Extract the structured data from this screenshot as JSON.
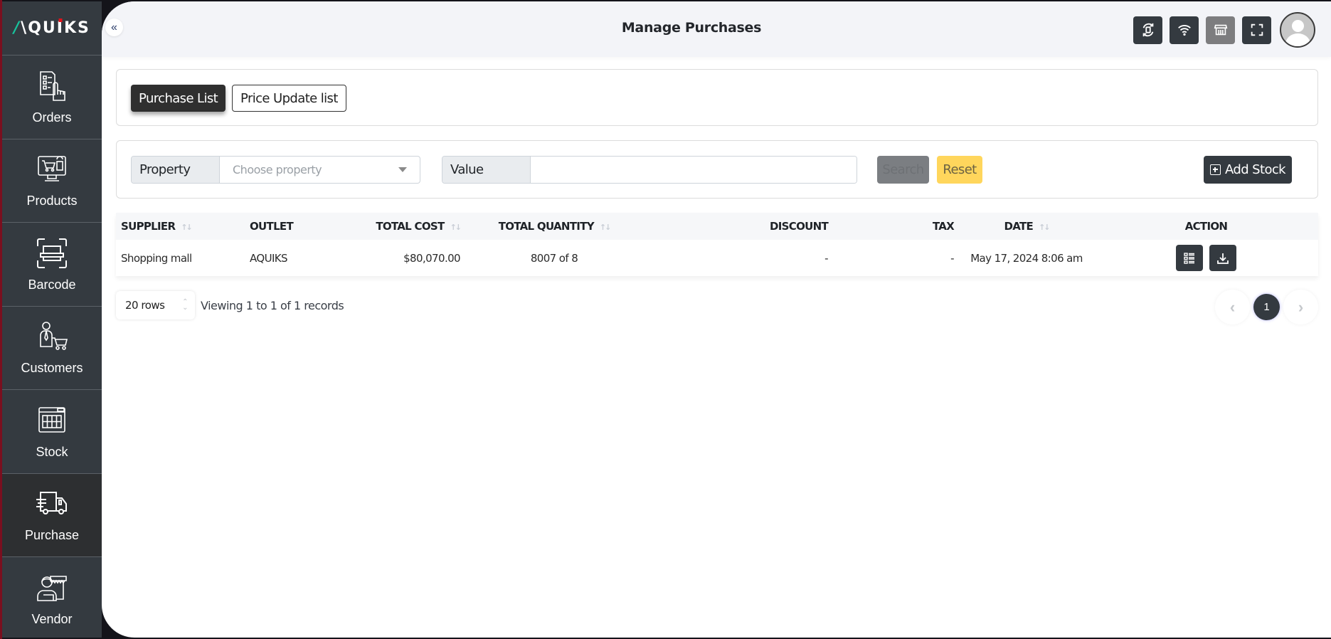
{
  "app": {
    "logo_text": "AQUIKS",
    "page_title": "Manage Purchases"
  },
  "sidebar": {
    "items": [
      {
        "label": "Orders",
        "icon": "orders-icon",
        "active": false
      },
      {
        "label": "Products",
        "icon": "products-icon",
        "active": false
      },
      {
        "label": "Barcode",
        "icon": "barcode-scan-icon",
        "active": false
      },
      {
        "label": "Customers",
        "icon": "customer-cart-icon",
        "active": false
      },
      {
        "label": "Stock",
        "icon": "stock-icon",
        "active": false
      },
      {
        "label": "Purchase",
        "icon": "delivery-truck-icon",
        "active": true
      },
      {
        "label": "Vendor",
        "icon": "vendor-icon",
        "active": false
      }
    ]
  },
  "header": {
    "collapse_glyph": "«",
    "icons": [
      "sync-icon",
      "wifi-icon",
      "store-icon",
      "fullscreen-icon",
      "user-avatar"
    ]
  },
  "tabs": {
    "purchase_list": "Purchase List",
    "price_update_list": "Price Update list",
    "active": "purchase_list"
  },
  "filters": {
    "property_label": "Property",
    "property_placeholder": "Choose property",
    "value_label": "Value",
    "value_input": "",
    "search_label": "Search",
    "reset_label": "Reset",
    "add_stock_label": "Add Stock"
  },
  "table": {
    "columns": [
      {
        "label": "SUPPLIER",
        "sortable": true
      },
      {
        "label": "OUTLET",
        "sortable": false
      },
      {
        "label": "TOTAL COST",
        "sortable": true
      },
      {
        "label": "TOTAL QUANTITY",
        "sortable": true
      },
      {
        "label": "DISCOUNT",
        "sortable": false
      },
      {
        "label": "TAX",
        "sortable": false
      },
      {
        "label": "DATE",
        "sortable": true
      },
      {
        "label": "ACTION",
        "sortable": false
      }
    ],
    "rows": [
      {
        "supplier": "Shopping mall",
        "outlet": "AQUIKS",
        "total_cost": "$80,070.00",
        "total_quantity": "8007 of 8",
        "discount": "-",
        "tax": "-",
        "date": "May 17, 2024 8:06 am",
        "actions": [
          "details-icon",
          "download-icon"
        ]
      }
    ]
  },
  "footer": {
    "rows_per_page": "20 rows",
    "viewing_text": "Viewing 1 to 1 of 1 records",
    "pagination": {
      "prev": "‹",
      "current_page": "1",
      "next": "›"
    }
  },
  "colors": {
    "sidebar_bg": "#343a40",
    "active_nav_bg": "#2d2f31",
    "header_bg": "#f3f4f8",
    "primary_dark": "#343a40",
    "reset_yellow": "#ffd65c",
    "search_gray": "#7b7e82"
  }
}
